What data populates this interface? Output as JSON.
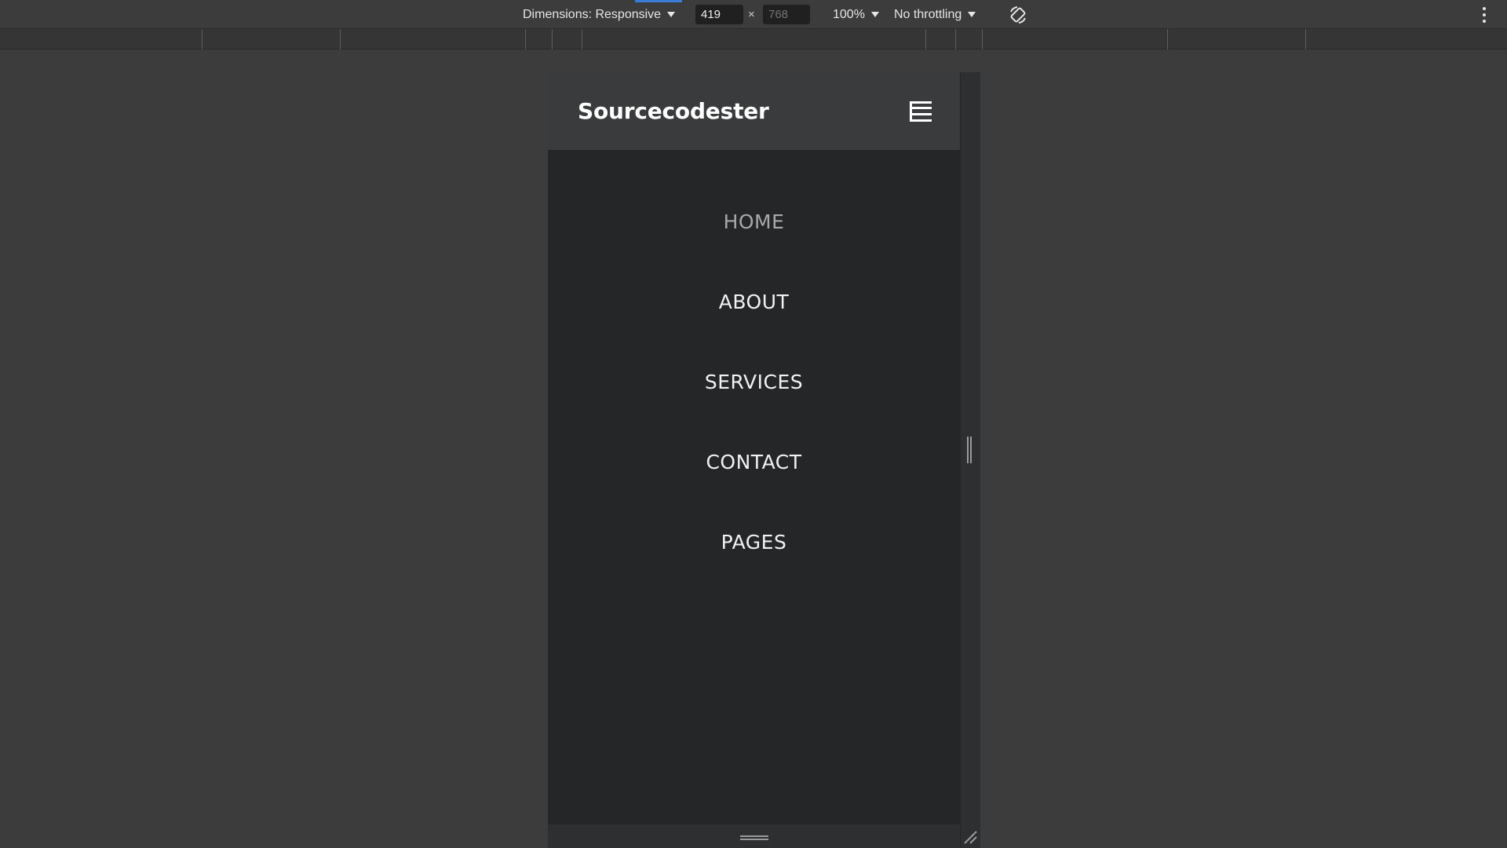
{
  "devtools": {
    "dimensions_label": "Dimensions: Responsive",
    "width_value": "419",
    "height_placeholder": "768",
    "times": "×",
    "zoom_label": "100%",
    "throttling_label": "No throttling",
    "icons": {
      "dimensions_caret": "caret-down-icon",
      "zoom_caret": "caret-down-icon",
      "throttling_caret": "caret-down-icon",
      "rotate": "rotate-icon",
      "more": "more-vertical-icon"
    }
  },
  "site": {
    "brand": "Sourcecodester",
    "menu_icon": "hamburger-menu-icon",
    "nav": [
      {
        "label": "HOME",
        "active": true
      },
      {
        "label": "ABOUT",
        "active": false
      },
      {
        "label": "SERVICES",
        "active": false
      },
      {
        "label": "CONTACT",
        "active": false
      },
      {
        "label": "PAGES",
        "active": false
      }
    ]
  },
  "colors": {
    "page_bg": "#3c3c3c",
    "device_bg": "#252627",
    "header_bg": "#3a3b3c",
    "nav_text": "#f2f2f2",
    "nav_active_text": "#a8a8a8",
    "accent": "#3a7bd5"
  }
}
